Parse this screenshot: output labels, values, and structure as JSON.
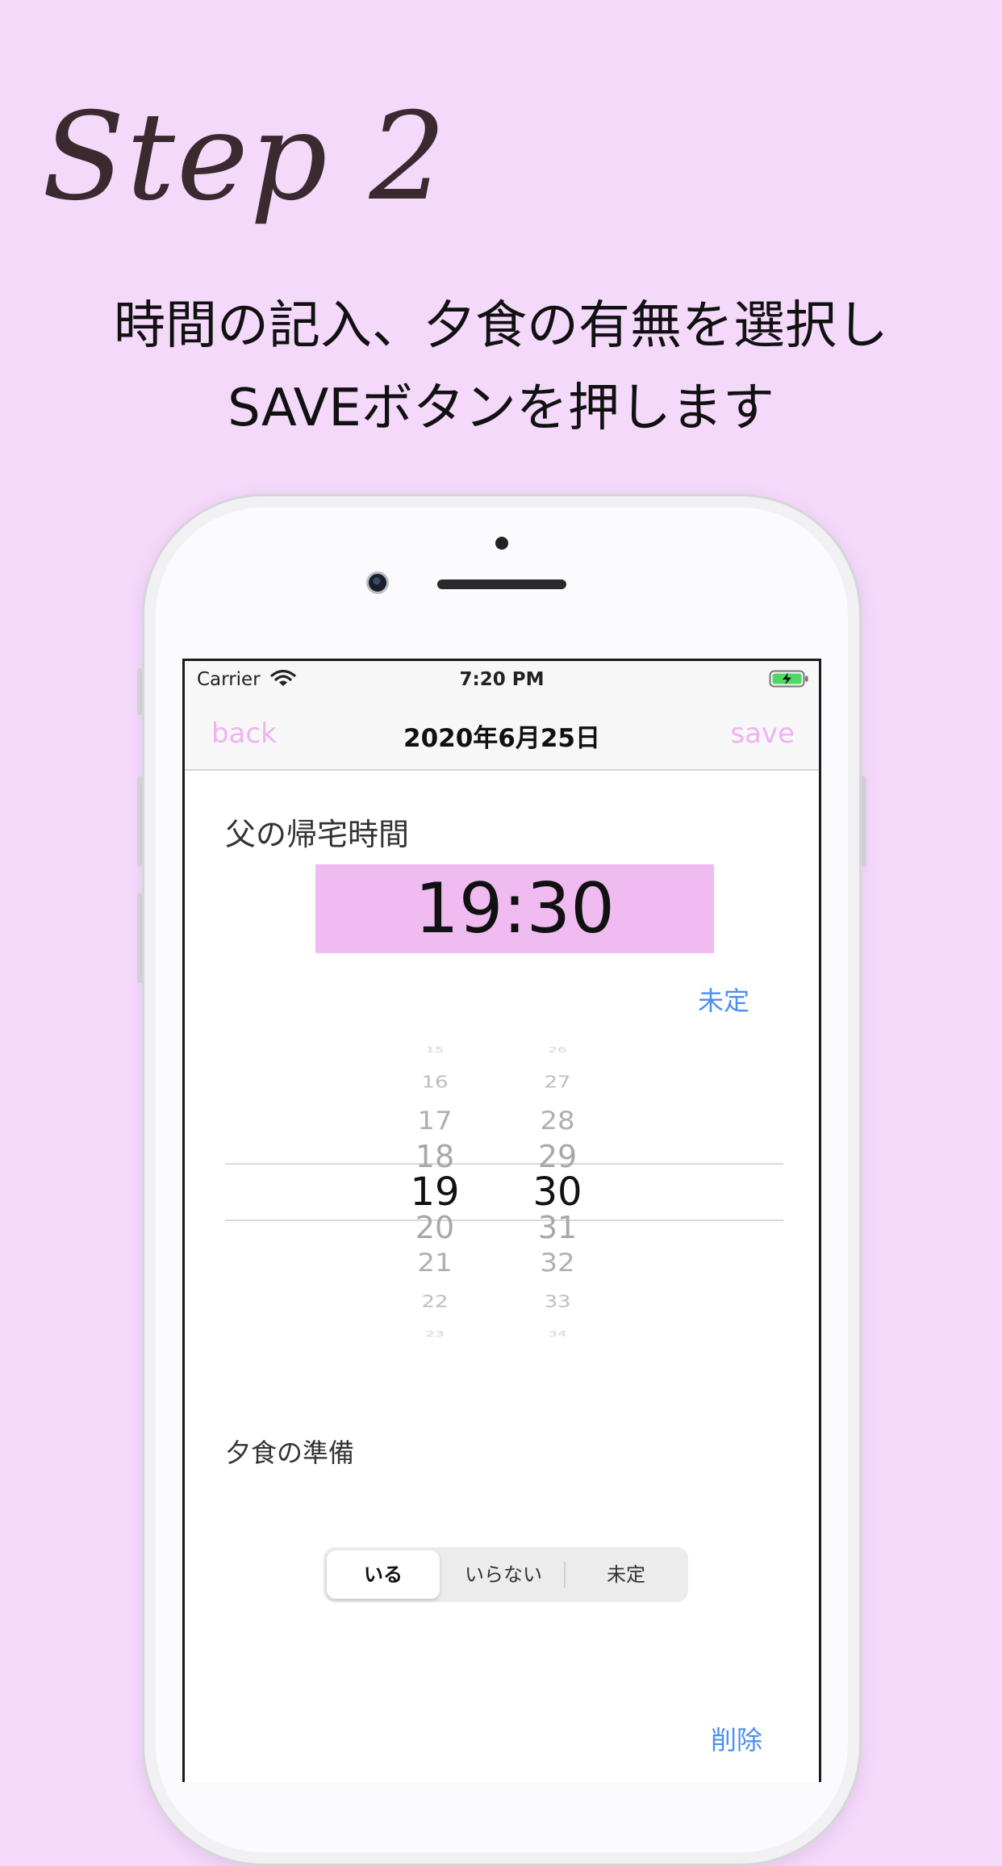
{
  "heading": {
    "step": "Step 2",
    "line1": "時間の記入、夕食の有無を選択し",
    "line2": "SAVEボタンを押します"
  },
  "status_bar": {
    "carrier": "Carrier",
    "time": "7:20 PM",
    "icons": [
      "wifi-icon",
      "battery-charging-icon"
    ]
  },
  "nav": {
    "back_label": "back",
    "title": "2020年6月25日",
    "save_label": "save"
  },
  "time_section": {
    "label": "父の帰宅時間",
    "display_time": "19:30",
    "undecided_label": "未定"
  },
  "picker": {
    "hours": [
      "15",
      "16",
      "17",
      "18",
      "19",
      "20",
      "21",
      "22",
      "23"
    ],
    "minutes": [
      "26",
      "27",
      "28",
      "29",
      "30",
      "31",
      "32",
      "33",
      "34"
    ],
    "selected_hour": "19",
    "selected_minute": "30"
  },
  "dinner_section": {
    "label": "夕食の準備",
    "options": [
      "いる",
      "いらない",
      "未定"
    ],
    "selected": "いる"
  },
  "delete_label": "削除",
  "colors": {
    "page_background": "#f5d9fb",
    "accent_pink": "#efbbf1",
    "nav_button_pink": "#f0b2f2",
    "link_blue": "#4a8ff2"
  }
}
